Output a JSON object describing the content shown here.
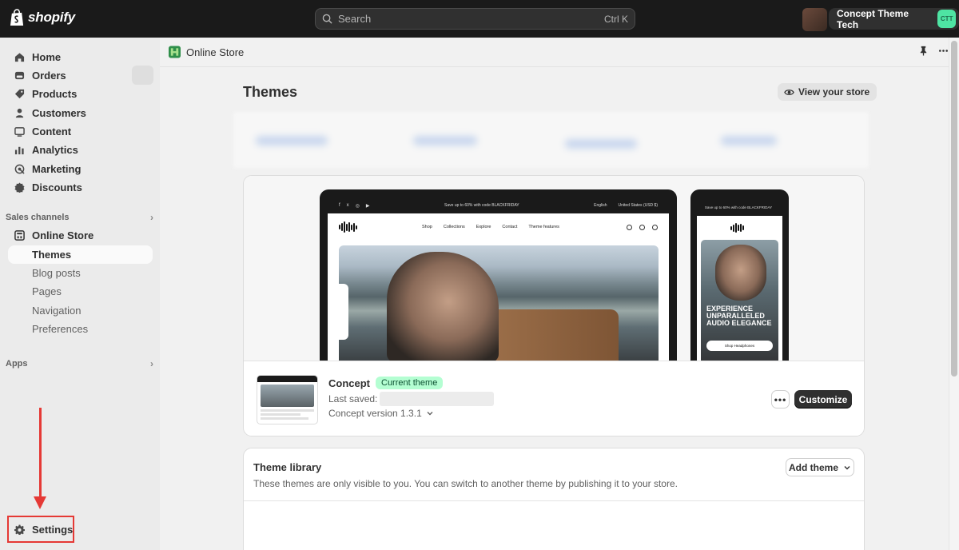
{
  "topbar": {
    "logo_text": "shopify",
    "search_placeholder": "Search",
    "search_shortcut": "Ctrl K",
    "store_name": "Concept Theme Tech",
    "avatar_initials": "CTT"
  },
  "sidebar": {
    "items": [
      {
        "label": "Home",
        "icon": "home-icon"
      },
      {
        "label": "Orders",
        "icon": "orders-icon"
      },
      {
        "label": "Products",
        "icon": "tag-icon"
      },
      {
        "label": "Customers",
        "icon": "person-icon"
      },
      {
        "label": "Content",
        "icon": "content-icon"
      },
      {
        "label": "Analytics",
        "icon": "bar-chart-icon"
      },
      {
        "label": "Marketing",
        "icon": "target-icon"
      },
      {
        "label": "Discounts",
        "icon": "discount-icon"
      }
    ],
    "sales_channels_label": "Sales channels",
    "online_store_label": "Online Store",
    "online_store_sub": [
      "Themes",
      "Blog posts",
      "Pages",
      "Navigation",
      "Preferences"
    ],
    "apps_label": "Apps",
    "settings_label": "Settings"
  },
  "header": {
    "app_title": "Online Store"
  },
  "page": {
    "title": "Themes",
    "view_store_label": "View your store"
  },
  "current_theme": {
    "preview": {
      "announcement": "Save up to 60% with code BLACKFRIDAY",
      "language": "English",
      "currency": "United States (USD $)",
      "nav_links": [
        "Shop",
        "Collections",
        "Explore",
        "Contact",
        "Theme features"
      ],
      "mobile_announcement": "Save up to 60% with code BLACKFRIDAY",
      "mobile_headline": "EXPERIENCE UNPARALLELED AUDIO ELEGANCE",
      "mobile_cta": "Shop Headphones"
    },
    "name": "Concept",
    "badge": "Current theme",
    "last_saved_label": "Last saved:",
    "version_label": "Concept version 1.3.1",
    "more_label": "•••",
    "customize_label": "Customize"
  },
  "theme_library": {
    "title": "Theme library",
    "description": "These themes are only visible to you. You can switch to another theme by publishing it to your store.",
    "add_theme_label": "Add theme"
  },
  "colors": {
    "topbar_bg": "#1a1a1a",
    "sidebar_bg": "#ebebeb",
    "badge_bg": "#b4fed2",
    "primary_button": "#303030",
    "annotation_red": "#e53935",
    "avatar_bg": "#4ee4a3"
  }
}
